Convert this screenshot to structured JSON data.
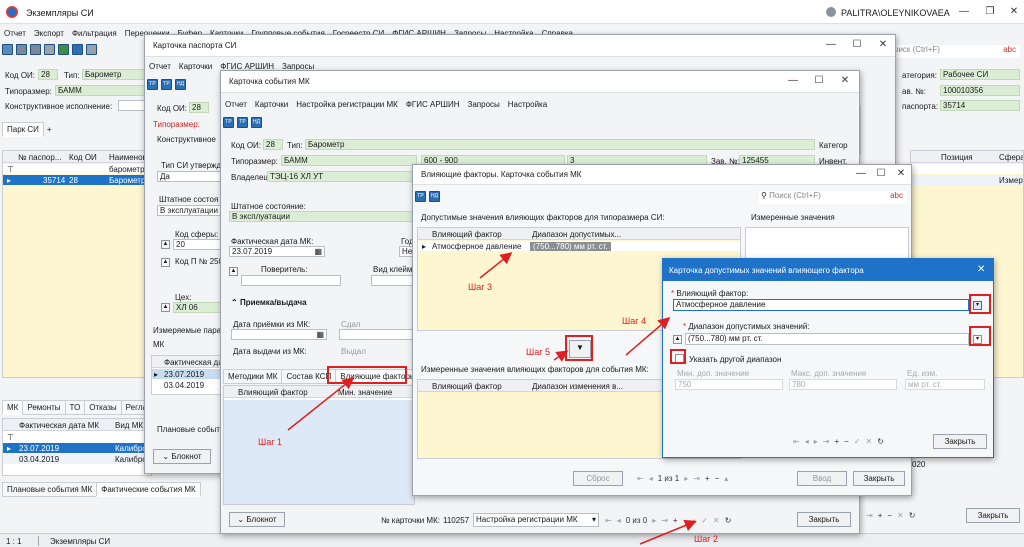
{
  "main": {
    "title": "Экземпляры СИ",
    "user": "PALITRA\\OLEYNIKOVAEA",
    "menu": [
      "Отчет",
      "Экспорт",
      "Фильтрация",
      "Переоценки",
      "Буфер",
      "Карточки",
      "Групповые события",
      "Госреестр СИ",
      "ФГИС АРШИН",
      "Запросы",
      "Настройка",
      "Справка"
    ],
    "search_placeholder": "оиск (Ctrl+F)",
    "search_tag": "abc",
    "fields": {
      "code_oi_label": "Код ОИ:",
      "code_oi": "28",
      "type_label": "Тип:",
      "type": "Барометр",
      "typesize_label": "Типоразмер:",
      "typesize": "БАММ",
      "constr_label": "Конструктивное исполнение:",
      "category_label": "атегория:",
      "category": "Рабочее СИ",
      "factory_label": "ав. №:",
      "factory": "100010356",
      "passport_label": "паспорта:",
      "passport": "35714"
    },
    "park_tab": "Парк СИ",
    "add_tab": "+",
    "grid": {
      "headers": [
        "№ паспор...",
        "Код ОИ",
        "Наименов",
        "Позиция",
        "Сфера"
      ],
      "filter_row": "барометр",
      "filter_tail": "Измер",
      "rows": [
        {
          "passport": "35714",
          "code": "28",
          "name": "Барометр"
        }
      ]
    },
    "bottom_tabs": [
      "МК",
      "Ремонты",
      "ТО",
      "Отказы",
      "Регламент"
    ],
    "mk_grid": {
      "headers": [
        "Фактическая дата МК",
        "Вид МК"
      ],
      "rows": [
        {
          "date": "23.07.2019",
          "kind": "Калибро"
        },
        {
          "date": "03.04.2019",
          "kind": "Калибро"
        }
      ]
    },
    "event_tabs": [
      "Плановые события МК",
      "Фактические события МК"
    ],
    "year_fragment": "020",
    "close": "Закрыть",
    "status": [
      "1 : 1",
      "Экземпляры СИ"
    ]
  },
  "passport": {
    "title": "Карточка паспорта СИ",
    "menu": [
      "Отчет",
      "Карточки",
      "ФГИС АРШИН",
      "Запросы"
    ],
    "code_oi_label": "Код ОИ:",
    "code_oi": "28",
    "typesize_label": "Типоразмер:",
    "constr_label": "Конструктивное",
    "tip_util_label": "Тип СИ утвержд",
    "tip_util": "Да",
    "state_label": "Штатное состоя",
    "state": "В эксплуатации",
    "sphere_label": "Код сферы:",
    "sphere": "20",
    "code_p_label": "Код П № 250",
    "ceh_label": "Цех:",
    "ceh": "ХЛ 06",
    "measured_label": "Измеряемые пара",
    "mk_label": "МК",
    "fact_label": "Фактическая да",
    "dates": [
      "23.07.2019",
      "03.04.2019"
    ],
    "planned_label": "Плановые событи",
    "notebook": "Блокнот"
  },
  "event": {
    "title": "Карточка события МК",
    "menu": [
      "Отчет",
      "Карточки",
      "Настройка регистрации МК",
      "ФГИС АРШИН",
      "Запросы",
      "Настройка"
    ],
    "code_oi_label": "Код ОИ:",
    "code_oi": "28",
    "type_label": "Тип:",
    "type": "Барометр",
    "categ_label": "Категор",
    "typesize_label": "Типоразмер:",
    "typesize": "БАММ",
    "range": "600 - 900",
    "class": "3",
    "factory_label": "Зав. №:",
    "factory": "125455",
    "invent_label": "Инвент.",
    "owner_label": "Владелец:",
    "owner": "ТЭЦ-16 ХЛ УТ",
    "state_label": "Штатное состояние:",
    "state": "В эксплуатации",
    "fact_label": "Фактическая дата МК:",
    "fact_date": "23.07.2019",
    "god_label": "Год",
    "god_value": "Нет",
    "verifier_label": "Поверитель:",
    "brand_label": "Вид клейм",
    "section_priem": "Приемка/выдача",
    "accept_label": "Дата приёмки из МК:",
    "issue_label": "Дата выдачи из МК:",
    "gave_label": "Сдал",
    "took_label": "Выдал",
    "tabs": [
      "Методики МК",
      "Состав КСП",
      "Влияющие факторы"
    ],
    "factor_head": [
      "Влияющий фактор",
      "Мин. значение"
    ],
    "notebook": "Блокнот",
    "card_no_label": "№ карточки МК:",
    "card_no": "110257",
    "reg_setting": "Настройка регистрации МК",
    "pager": "0 из 0",
    "close": "Закрыть"
  },
  "factors": {
    "title": "Влияющие факторы. Карточка события МК",
    "search_placeholder": "Поиск (Ctrl+F)",
    "search_tag": "abc",
    "allowed_caption": "Допустимые значения влияющих факторов для типоразмера СИ:",
    "allowed_head": [
      "Влияющий фактор",
      "Диапазон допустимых..."
    ],
    "allowed_row": {
      "factor": "Атмосферное давление",
      "range": "(750...780) мм рт. ст."
    },
    "measured_side": "Измеренные значения",
    "measured_caption": "Измеренные значения влияющих факторов для события МК:",
    "measured_head": [
      "Влияющий фактор",
      "Диапазон изменения в..."
    ],
    "reset": "Сброс",
    "pager": "1 из 1",
    "enter": "Ввод",
    "close": "Закрыть"
  },
  "range_card": {
    "title": "Карточка допустимых значений влияющего фактора",
    "factor_label": "Влияющий фактор:",
    "factor": "Атмосферное давление",
    "range_label": "Диапазон допустимых значений:",
    "range": "(750...780) мм рт. ст.",
    "other_range": "Указать другой диапазон",
    "min_label": "Мин. доп. значение",
    "min": "750",
    "max_label": "Макс. доп. значение",
    "max": "780",
    "unit_label": "Ед. изм.",
    "unit": "мм рт. ст.",
    "close": "Закрыть"
  },
  "steps": {
    "s1": "Шаг 1",
    "s2": "Шаг 2",
    "s3": "Шаг 3",
    "s4": "Шаг 4",
    "s5": "Шаг 5"
  },
  "colors": {
    "accent": "#1e73c8",
    "green_field": "#dbeed5",
    "yellow_bg": "#fdf6d0",
    "selection": "#c7dcf0",
    "annotation": "#e02020"
  }
}
